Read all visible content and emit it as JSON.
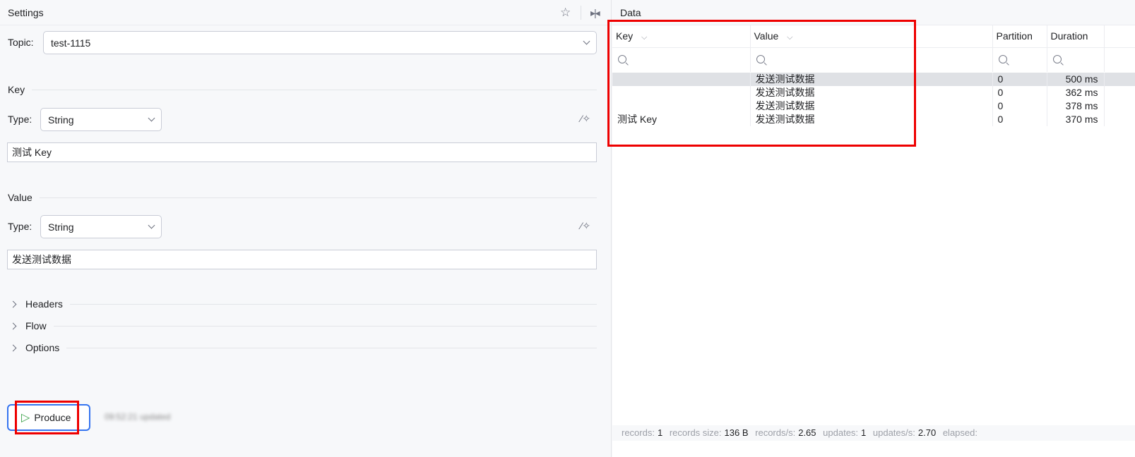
{
  "settings": {
    "title": "Settings",
    "topic_label": "Topic:",
    "topic_value": "test-1115",
    "key": {
      "section": "Key",
      "type_label": "Type:",
      "type_value": "String",
      "value": "测试 Key"
    },
    "value": {
      "section": "Value",
      "type_label": "Type:",
      "type_value": "String",
      "value": "发送测试数据"
    },
    "sections": [
      "Headers",
      "Flow",
      "Options"
    ],
    "produce_label": "Produce",
    "updated_text": "09:52:21 updated"
  },
  "data": {
    "title": "Data",
    "columns": [
      "Key",
      "Value",
      "Partition",
      "Duration"
    ],
    "rows": [
      {
        "key": "",
        "value": "发送测试数据",
        "partition": "0",
        "duration": "500 ms"
      },
      {
        "key": "",
        "value": "发送测试数据",
        "partition": "0",
        "duration": "362 ms"
      },
      {
        "key": "",
        "value": "发送测试数据",
        "partition": "0",
        "duration": "378 ms"
      },
      {
        "key": "测试 Key",
        "value": "发送测试数据",
        "partition": "0",
        "duration": "370 ms"
      }
    ],
    "status": {
      "records_label": "records:",
      "records": "1",
      "size_label": "records size:",
      "size": "136 B",
      "rps_label": "records/s:",
      "rps": "2.65",
      "updates_label": "updates:",
      "updates": "1",
      "ups_label": "updates/s:",
      "ups": "2.70",
      "elapsed_label": "elapsed:"
    }
  },
  "colors": {
    "accent": "#3574f0",
    "highlight": "#ff0000",
    "selected_row": "#dfe1e5"
  }
}
